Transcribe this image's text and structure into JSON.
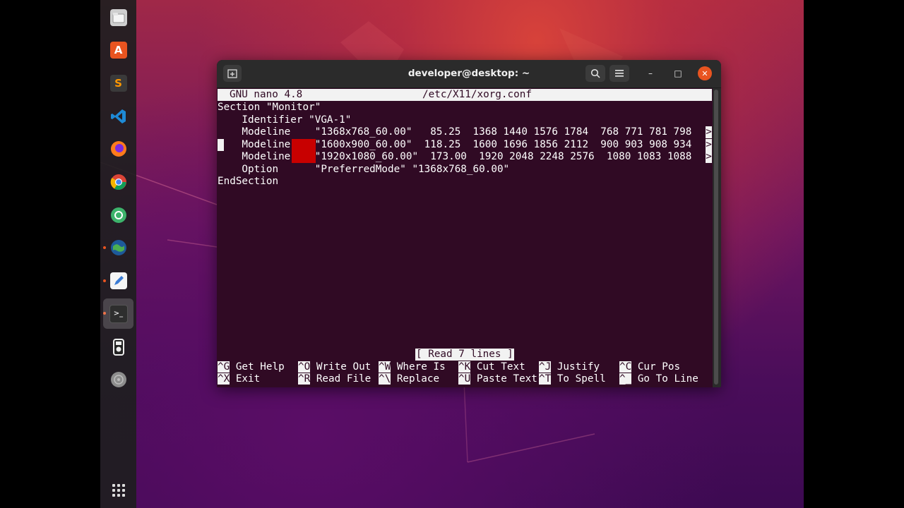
{
  "colors": {
    "terminal_bg": "#300a24",
    "terminal_fg": "#ffffff",
    "accent": "#e95420",
    "marker": "#c80000"
  },
  "dock": {
    "items": [
      {
        "name": "files-icon",
        "running": false
      },
      {
        "name": "software-center-icon",
        "running": false
      },
      {
        "name": "sublime-text-icon",
        "running": false
      },
      {
        "name": "vscode-icon",
        "running": false
      },
      {
        "name": "firefox-icon",
        "running": false
      },
      {
        "name": "chrome-icon",
        "running": false
      },
      {
        "name": "app-icon",
        "running": false
      },
      {
        "name": "globe-browser-icon",
        "running": true
      },
      {
        "name": "text-editor-icon",
        "running": true
      },
      {
        "name": "terminal-icon",
        "running": true,
        "active": true
      },
      {
        "name": "media-player-icon",
        "running": false
      },
      {
        "name": "disc-icon",
        "running": false
      }
    ],
    "apps_grid_icon": "show-applications-icon"
  },
  "window": {
    "title": "developer@desktop: ~",
    "new_tab_icon": "new-tab-icon",
    "search_icon": "search-icon",
    "menu_icon": "hamburger-menu-icon",
    "minimize_glyph": "–",
    "maximize_glyph": "□",
    "close_glyph": "✕"
  },
  "nano": {
    "version": "GNU nano 4.8",
    "filename": "/etc/X11/xorg.conf",
    "lines": [
      "Section \"Monitor\"",
      "    Identifier \"VGA-1\"",
      "    Modeline    \"1368x768_60.00\"   85.25  1368 1440 1576 1784  768 771 781 798 ",
      "    Modeline    \"1600x900_60.00\"  118.25  1600 1696 1856 2112  900 903 908 934 ",
      "    Modeline    \"1920x1080_60.00\"  173.00  1920 2048 2248 2576  1080 1083 1088 ",
      "    Option      \"PreferredMode\" \"1368x768_60.00\"",
      "EndSection"
    ],
    "more_indicator": ">",
    "status": "[ Read 7 lines ]",
    "shortcuts_row1": [
      {
        "key": "^G",
        "label": " Get Help"
      },
      {
        "key": "^O",
        "label": " Write Out"
      },
      {
        "key": "^W",
        "label": " Where Is"
      },
      {
        "key": "^K",
        "label": " Cut Text"
      },
      {
        "key": "^J",
        "label": " Justify"
      },
      {
        "key": "^C",
        "label": " Cur Pos"
      }
    ],
    "shortcuts_row2": [
      {
        "key": "^X",
        "label": " Exit"
      },
      {
        "key": "^R",
        "label": " Read File"
      },
      {
        "key": "^\\",
        "label": " Replace"
      },
      {
        "key": "^U",
        "label": " Paste Text"
      },
      {
        "key": "^T",
        "label": " To Spell"
      },
      {
        "key": "^_",
        "label": " Go To Line"
      }
    ]
  }
}
